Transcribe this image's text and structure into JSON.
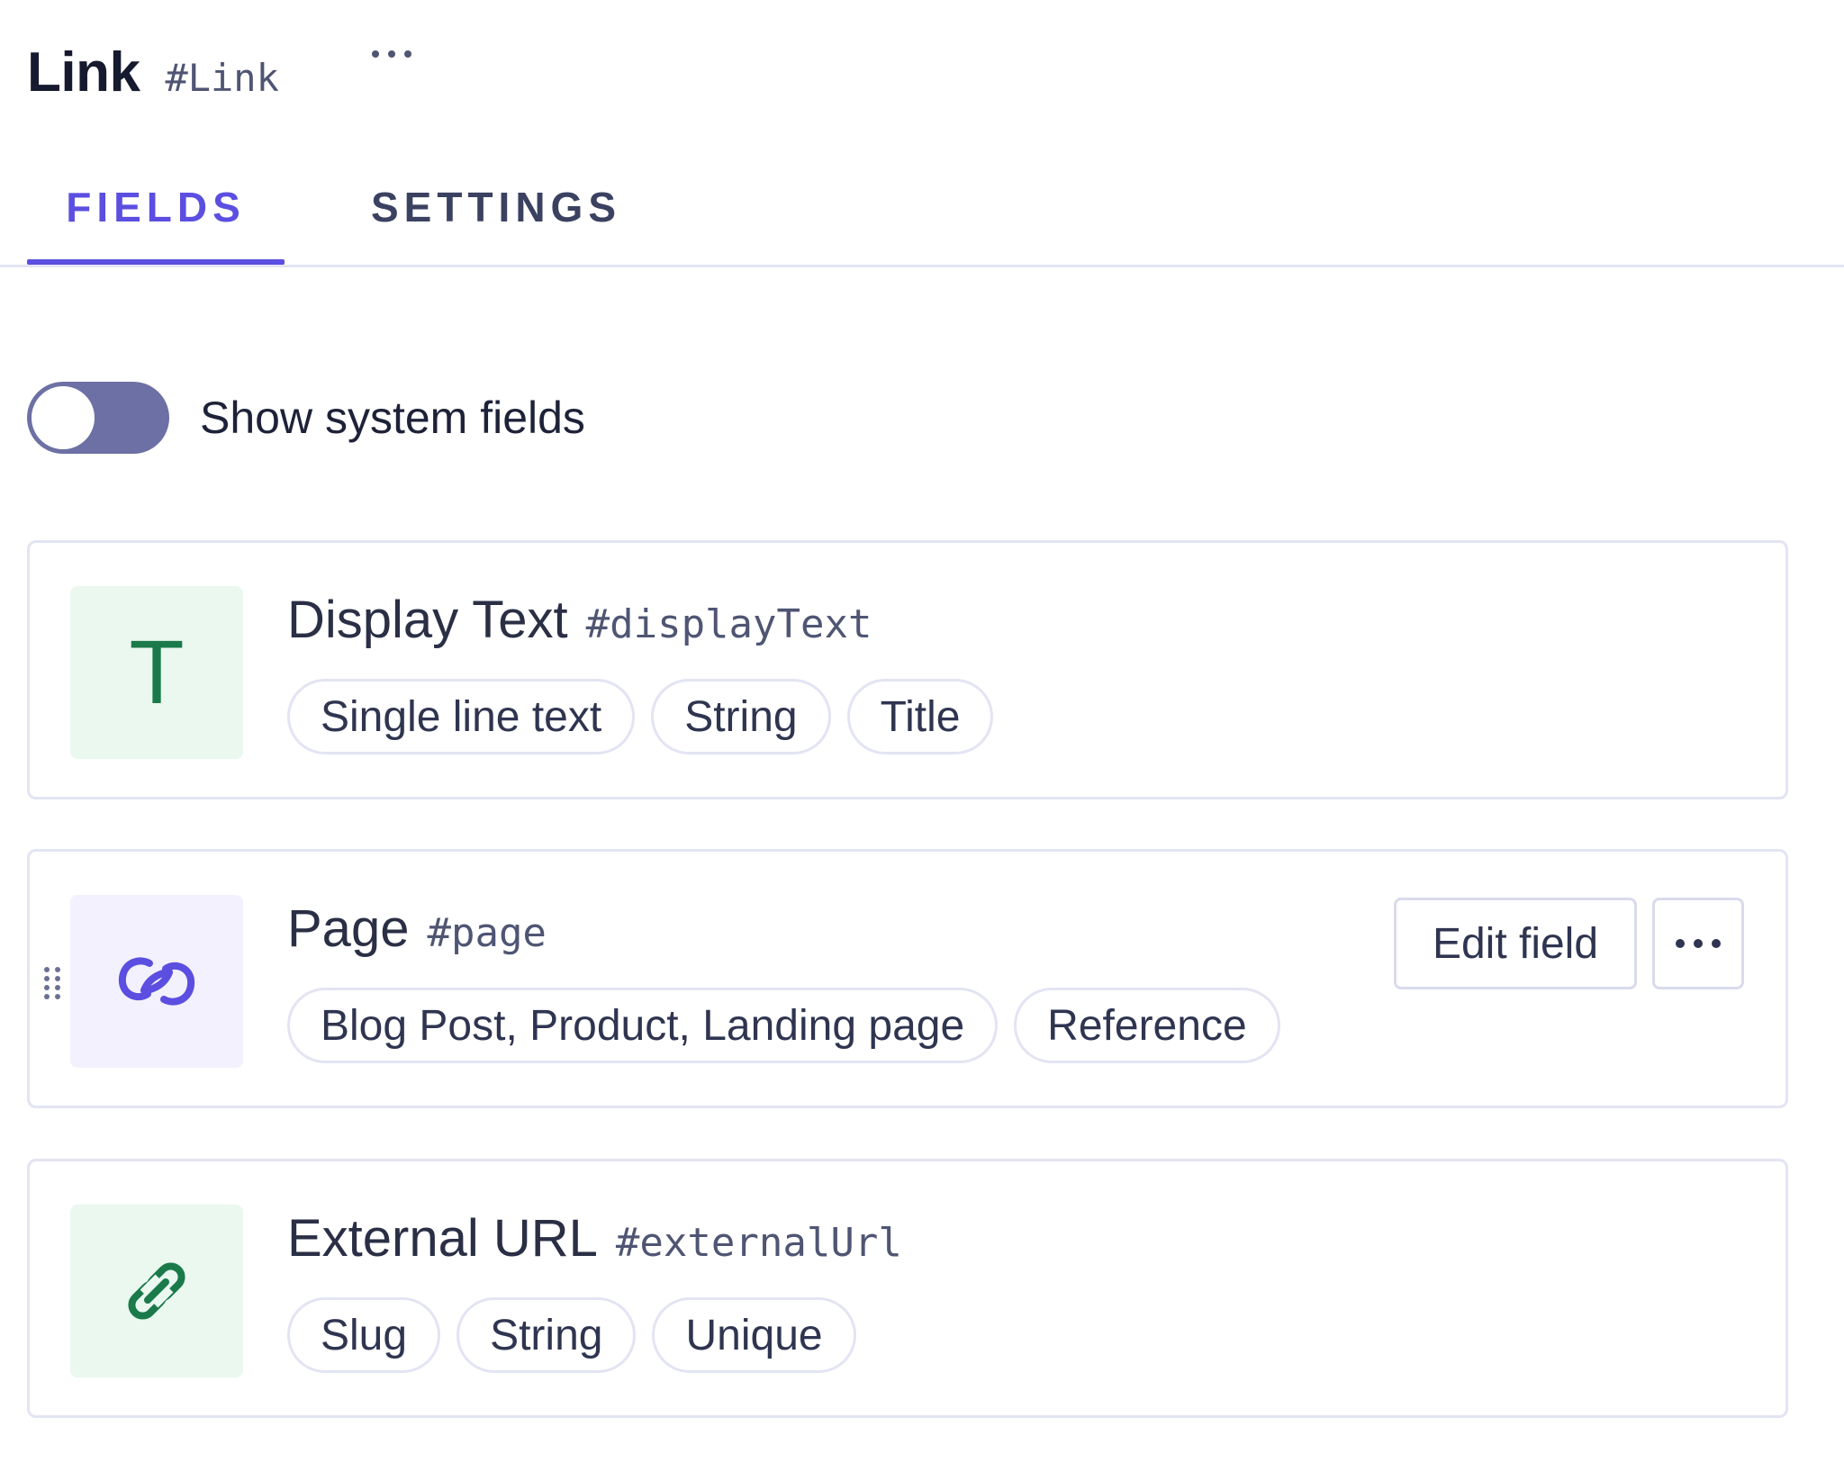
{
  "model": {
    "name": "Link",
    "api_id": "#Link",
    "menu_icon": "ellipsis-icon"
  },
  "tabs": [
    {
      "label": "FIELDS",
      "active": true
    },
    {
      "label": "SETTINGS",
      "active": false
    }
  ],
  "system_fields_toggle": {
    "label": "Show system fields",
    "on": false
  },
  "fields": [
    {
      "name": "Display Text",
      "api_id": "#displayText",
      "icon": "text-T-icon",
      "icon_color": "#1b7a4a",
      "icon_bg": "#eaf8f0",
      "chips": [
        "Single line text",
        "String",
        "Title"
      ]
    },
    {
      "name": "Page",
      "api_id": "#page",
      "icon": "reference-link-icon",
      "icon_color": "#5b4ee0",
      "icon_bg": "#f2f1fd",
      "chips": [
        "Blog Post, Product, Landing page",
        "Reference"
      ],
      "actions": {
        "edit_label": "Edit field",
        "more_icon": "ellipsis-icon"
      },
      "hovered": true
    },
    {
      "name": "External URL",
      "api_id": "#externalUrl",
      "icon": "slug-link-icon",
      "icon_color": "#1b7a4a",
      "icon_bg": "#eaf8f0",
      "chips": [
        "Slug",
        "String",
        "Unique"
      ]
    }
  ],
  "colors": {
    "accent": "#5b4ee0",
    "toggle_track": "#6c70a4",
    "border": "#e3e4f3"
  }
}
